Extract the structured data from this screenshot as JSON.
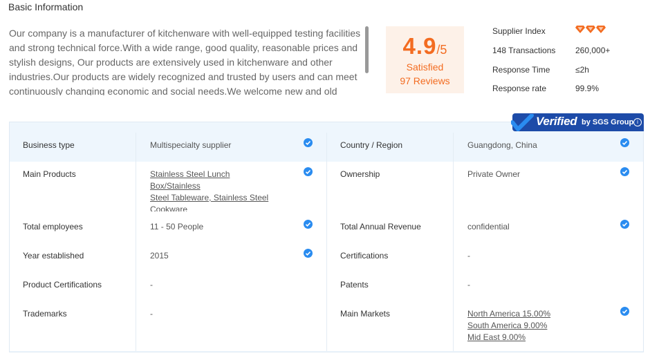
{
  "section": {
    "title": "Basic Information"
  },
  "description": "Our company is a manufacturer of kitchenware with well-equipped testing facilities and strong technical force.With a wide range, good quality, reasonable prices and stylish designs, Our products are extensively used in kitchenware and other industries.Our products are widely recognized and trusted by users and can meet continuously changing economic and social needs.We welcome new and old",
  "score": {
    "value": "4.9",
    "max": "/5",
    "label": "Satisfied",
    "reviews": "97 Reviews"
  },
  "stats": {
    "supplier_index_label": "Supplier Index",
    "supplier_index_diamonds": 3,
    "transactions_label": "148 Transactions",
    "transactions_value": "260,000+",
    "response_time_label": "Response Time",
    "response_time_value": "≤2h",
    "response_rate_label": "Response rate",
    "response_rate_value": "99.9%"
  },
  "verified_banner": {
    "verified": "Verified",
    "by": "by SGS Group",
    "info": "i"
  },
  "colors": {
    "accent": "#f36c21",
    "verified_blue": "#1d4ba8",
    "badge_blue": "#2a8cf0"
  },
  "table": {
    "business_type": {
      "label": "Business type",
      "value": "Multispecialty supplier"
    },
    "country": {
      "label": "Country / Region",
      "value": "Guangdong, China"
    },
    "main_products": {
      "label": "Main Products",
      "lines": [
        "Stainless Steel Lunch Box/Stainless",
        "Steel Tableware, Stainless Steel",
        "Cookware"
      ]
    },
    "ownership": {
      "label": "Ownership",
      "value": "Private Owner"
    },
    "total_employees": {
      "label": "Total employees",
      "value": "11 - 50 People"
    },
    "annual_revenue": {
      "label": "Total Annual Revenue",
      "value": "confidential"
    },
    "year_established": {
      "label": "Year established",
      "value": "2015"
    },
    "certifications": {
      "label": "Certifications",
      "value": "-"
    },
    "product_certifications": {
      "label": "Product Certifications",
      "value": "-"
    },
    "patents": {
      "label": "Patents",
      "value": "-"
    },
    "trademarks": {
      "label": "Trademarks",
      "value": "-"
    },
    "main_markets": {
      "label": "Main Markets",
      "lines": [
        "North America 15.00%",
        "South America 9.00%",
        "Mid East 9.00%"
      ]
    }
  }
}
